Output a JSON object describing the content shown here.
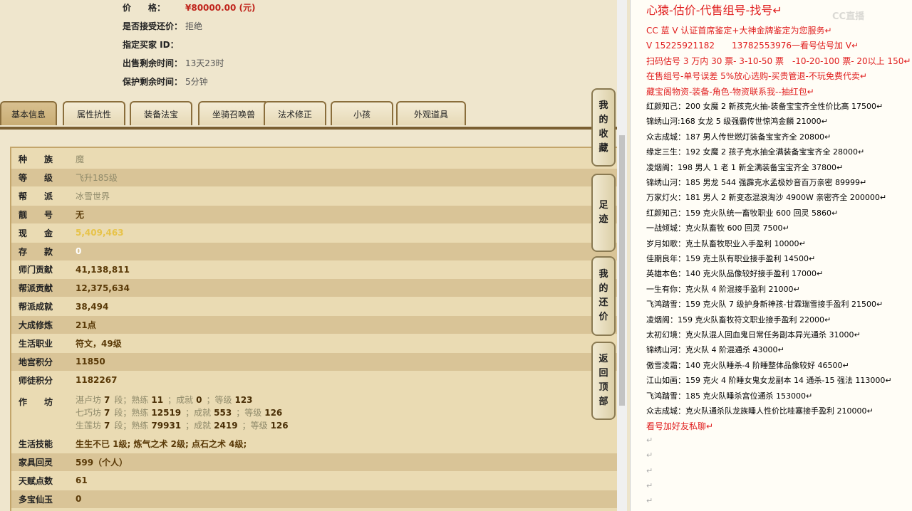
{
  "top_info": [
    {
      "label": "价　　格：",
      "value": "¥80000.00 (元)",
      "price": true
    },
    {
      "label": "是否接受还价：",
      "value": "拒绝"
    },
    {
      "label": "指定买家 ID：",
      "value": ""
    },
    {
      "label": "出售剩余时间：",
      "value": "13天23时"
    },
    {
      "label": "保护剩余时间：",
      "value": "5分钟"
    }
  ],
  "tabs": [
    "基本信息",
    "属性抗性",
    "装备法宝",
    "坐骑召唤兽",
    "法术修正",
    "小孩",
    "外观道具"
  ],
  "stats": [
    {
      "k": "种　　族",
      "v": "魔",
      "style": "dim"
    },
    {
      "k": "等　　级",
      "v": "飞升185级",
      "style": "dim"
    },
    {
      "k": "帮　　派",
      "v": "冰雪世界",
      "style": "dim"
    },
    {
      "k": "靓　　号",
      "v": "无",
      "style": ""
    },
    {
      "k": "现　　金",
      "v": "5,409,463",
      "style": "gold"
    },
    {
      "k": "存　　款",
      "v": "0",
      "style": "white"
    },
    {
      "k": "师门贡献",
      "v": "41,138,811",
      "style": ""
    },
    {
      "k": "帮派贡献",
      "v": "12,375,634",
      "style": ""
    },
    {
      "k": "帮派成就",
      "v": "38,494",
      "style": ""
    },
    {
      "k": "大成修炼",
      "v": "21点",
      "style": ""
    },
    {
      "k": "生活职业",
      "v": "符文，49级",
      "style": ""
    },
    {
      "k": "地宫积分",
      "v": "11850",
      "style": ""
    },
    {
      "k": "师徒积分",
      "v": "1182267",
      "style": ""
    }
  ],
  "workshop": {
    "label": "作　　坊",
    "lines": [
      {
        "name": "湛卢坊",
        "d": "7",
        "p": "11",
        "c": "0",
        "l": "123"
      },
      {
        "name": "七巧坊",
        "d": "7",
        "p": "12519",
        "c": "553",
        "l": "126"
      },
      {
        "name": "生莲坊",
        "d": "7",
        "p": "79931",
        "c": "2419",
        "l": "126"
      }
    ],
    "w_duan": "段；熟练",
    "w_cj": "；成就",
    "w_dj": "；等级"
  },
  "stats2": [
    {
      "k": "生活技能",
      "v": "生生不已 1级; 炼气之术 2级; 点石之术 4级;"
    },
    {
      "k": "家具回灵",
      "v": "599（个人）"
    },
    {
      "k": "天赋点数",
      "v": "61"
    },
    {
      "k": "多宝仙玉",
      "v": "0"
    }
  ],
  "side_buttons": [
    "我的收藏",
    "足迹",
    "我的还价",
    "返回顶部"
  ],
  "right_lines": [
    {
      "t": "心猿-估价-代售组号-找号↵",
      "c": "big"
    },
    {
      "t": "CC 蓝 V 认证首席鉴定+大神金牌鉴定为您服务↵",
      "c": "red"
    },
    {
      "t": "V 15225921182　　13782553976一看号估号加 V↵",
      "c": "red"
    },
    {
      "t": "扫码估号 3 万内 30 票- 3-10-50 票　-10-20-100 票- 20以上 150↵",
      "c": "red"
    },
    {
      "t": "在售组号-单号误差 5%放心选购-买贵管退-不玩免费代卖↵",
      "c": "red"
    },
    {
      "t": "藏宝阁物资-装备-角色-物资联系我--抽红包↵",
      "c": "red"
    },
    {
      "t": "红颜知己：200 女魔 2 新孩克火抽-装备宝宝齐全性价比高 17500↵",
      "c": ""
    },
    {
      "t": "锦绣山河:168 女龙 5 级强霸传世惊鸿金麟 21000↵",
      "c": ""
    },
    {
      "t": "众志成城：187 男人传世燃灯装备宝宝齐全 20800↵",
      "c": ""
    },
    {
      "t": "缘定三生：192 女魔 2 孩子克水抽全满装备宝宝齐全 28000↵",
      "c": ""
    },
    {
      "t": "凌烟阁：198 男人 1 老 1 新全满装备宝宝齐全 37800↵",
      "c": ""
    },
    {
      "t": "锦绣山河：185 男龙 544 强霹克水孟极妙音百万亲密 89999↵",
      "c": ""
    },
    {
      "t": "万家灯火：181 男人 2 新变态混浪淘沙 4900W 亲密齐全 200000↵",
      "c": ""
    },
    {
      "t": "红颜知己：159 克火队统一畜牧职业 600 回灵 5860↵",
      "c": ""
    },
    {
      "t": "一战倾城：克火队畜牧 600 回灵 7500↵",
      "c": ""
    },
    {
      "t": "岁月如歌：克土队畜牧职业入手盈利 10000↵",
      "c": ""
    },
    {
      "t": "佳期良年：159 克土队有职业接手盈利 14500↵",
      "c": ""
    },
    {
      "t": "英雄本色：140 克火队品像较好接手盈利 17000↵",
      "c": ""
    },
    {
      "t": "一生有你：克火队 4 阶混接手盈利 21000↵",
      "c": ""
    },
    {
      "t": "飞鸿踏雪：159 克火队 7 级护身新神孩-甘霖瑞雪接手盈利 21500↵",
      "c": ""
    },
    {
      "t": "凌烟阁：159 克火队畜牧符文职业接手盈利 22000↵",
      "c": ""
    },
    {
      "t": "太初幻境：克火队混人回血鬼日常任务副本异光通杀 31000↵",
      "c": ""
    },
    {
      "t": "锦绣山河：克火队 4 阶混通杀 43000↵",
      "c": ""
    },
    {
      "t": "傲雪凌霜：140 克火队睡杀-4 阶睡整体品像较好 46500↵",
      "c": ""
    },
    {
      "t": "江山如画：159 克火 4 阶睡女鬼女龙副本 14 通杀-15 强法 113000↵",
      "c": ""
    },
    {
      "t": "飞鸿踏雪：185 克火队睡杀宫位通杀 153000↵",
      "c": ""
    },
    {
      "t": "众志成城：克火队通杀队龙族睡人性价比哇塞接手盈利 210000↵",
      "c": ""
    },
    {
      "t": "看号加好友私聊↵",
      "c": "red"
    },
    {
      "t": "↵",
      "c": "mark"
    },
    {
      "t": "↵",
      "c": "mark"
    },
    {
      "t": "↵",
      "c": "mark"
    },
    {
      "t": "↵",
      "c": "mark"
    },
    {
      "t": "↵",
      "c": "mark"
    }
  ],
  "watermark": "CC直播"
}
